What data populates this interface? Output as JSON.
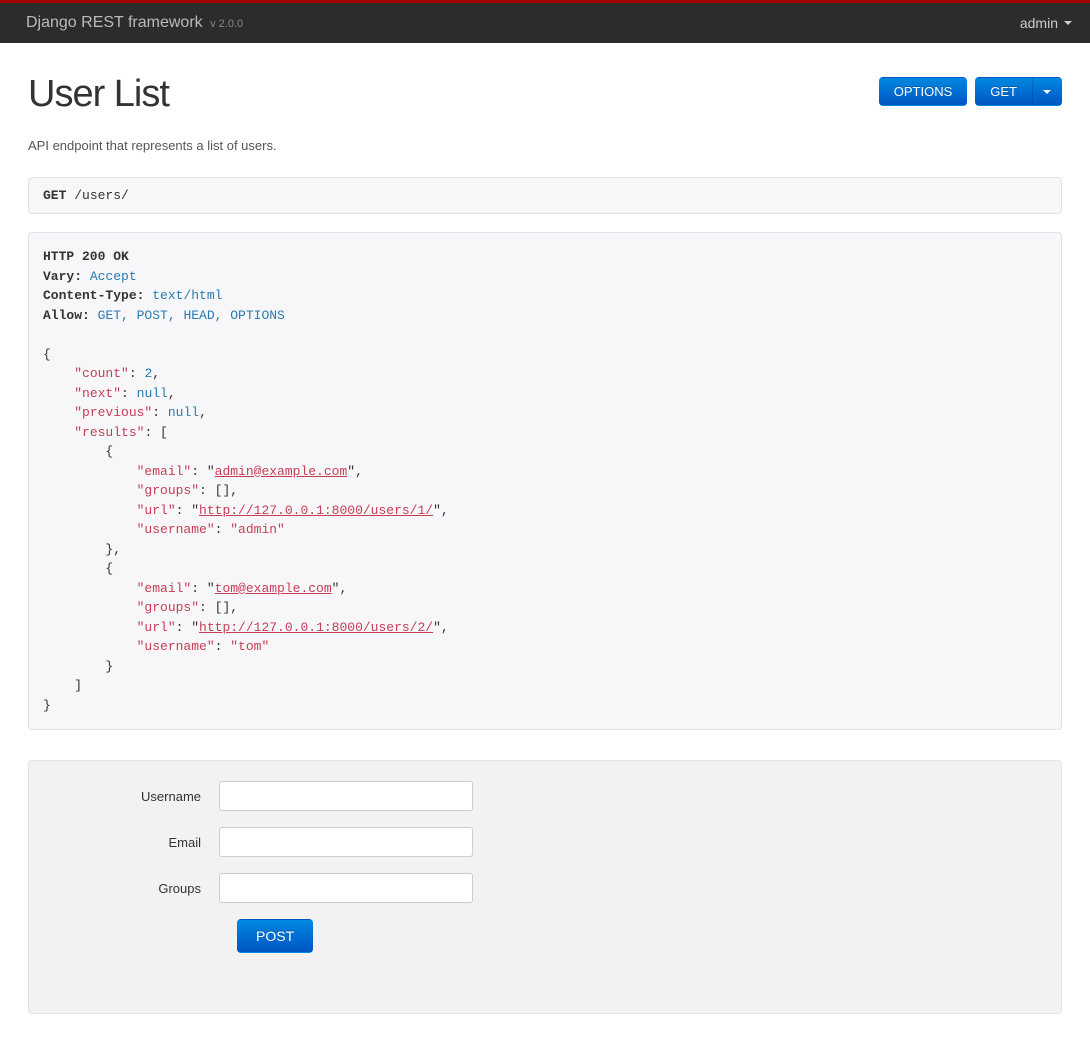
{
  "navbar": {
    "brand": "Django REST framework",
    "version": "v 2.0.0",
    "user": "admin"
  },
  "page": {
    "title": "User List",
    "options_button": "OPTIONS",
    "get_button": "GET",
    "description": "API endpoint that represents a list of users."
  },
  "request": {
    "method": "GET",
    "path": "/users/"
  },
  "response": {
    "status_line": "HTTP 200 OK",
    "headers": {
      "vary_label": "Vary:",
      "vary_value": "Accept",
      "ct_label": "Content-Type:",
      "ct_value": "text/html",
      "allow_label": "Allow:",
      "allow_value": "GET, POST, HEAD, OPTIONS"
    },
    "body": {
      "count_key": "\"count\"",
      "count_val": "2",
      "next_key": "\"next\"",
      "next_val": "null",
      "prev_key": "\"previous\"",
      "prev_val": "null",
      "results_key": "\"results\"",
      "users": [
        {
          "email_key": "\"email\"",
          "email_val": "admin@example.com",
          "groups_key": "\"groups\"",
          "groups_val": "[]",
          "url_key": "\"url\"",
          "url_val": "http://127.0.0.1:8000/users/1/",
          "username_key": "\"username\"",
          "username_val": "\"admin\""
        },
        {
          "email_key": "\"email\"",
          "email_val": "tom@example.com",
          "groups_key": "\"groups\"",
          "groups_val": "[]",
          "url_key": "\"url\"",
          "url_val": "http://127.0.0.1:8000/users/2/",
          "username_key": "\"username\"",
          "username_val": "\"tom\""
        }
      ]
    }
  },
  "form": {
    "username_label": "Username",
    "email_label": "Email",
    "groups_label": "Groups",
    "post_button": "POST"
  }
}
